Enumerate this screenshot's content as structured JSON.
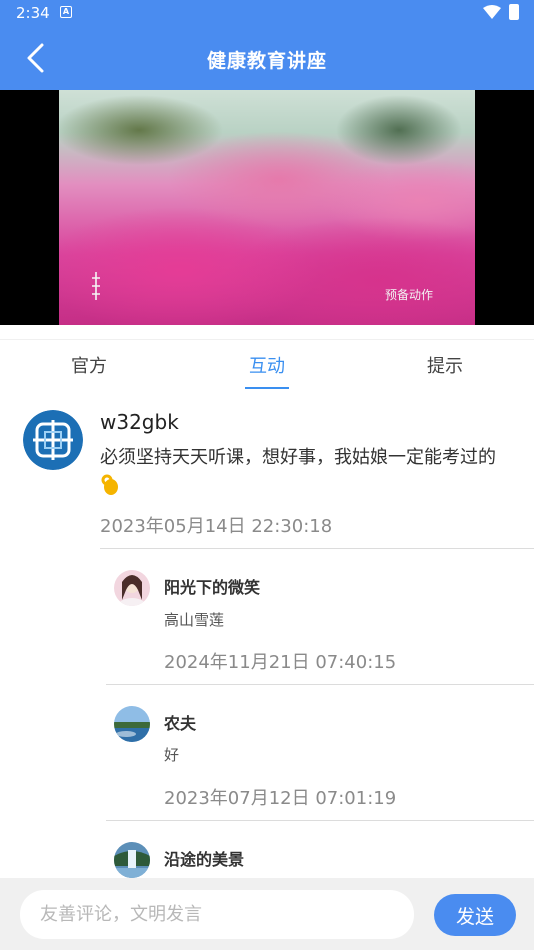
{
  "status_bar": {
    "time": "2:34",
    "notification_letter": "A"
  },
  "header": {
    "title": "健康教育讲座"
  },
  "video": {
    "watermark": "预备动作"
  },
  "tabs": [
    {
      "label": "官方",
      "active": false
    },
    {
      "label": "互动",
      "active": true
    },
    {
      "label": "提示",
      "active": false
    }
  ],
  "comment": {
    "username": "w32gbk",
    "text": "必须坚持天天听课，想好事，我姑娘一定能考过的",
    "emoji": "ok-hand-icon",
    "time": "2023年05月14日 22:30:18",
    "replies": [
      {
        "name": "阳光下的微笑",
        "text": "高山雪莲",
        "time": "2024年11月21日 07:40:15"
      },
      {
        "name": "农夫",
        "text": "好",
        "time": "2023年07月12日 07:01:19"
      },
      {
        "name": "沿途的美景",
        "text": "",
        "time": ""
      }
    ]
  },
  "input_bar": {
    "placeholder": "友善评论，文明发言",
    "send_label": "发送"
  },
  "colors": {
    "primary": "#4a8cf0",
    "tab_active": "#3a8ff0"
  }
}
